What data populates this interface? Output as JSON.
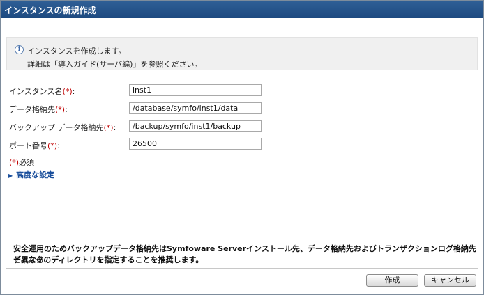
{
  "dialog": {
    "title": "インスタンスの新規作成"
  },
  "info": {
    "icon": "info-icon",
    "line1": "インスタンスを作成します。",
    "line2": "詳細は「導入ガイド(サーバ編)」を参照ください。"
  },
  "form": {
    "instance_name": {
      "label": "インスタンス名",
      "required_mark": "(*)",
      "colon": ":",
      "value": "inst1"
    },
    "data_dir": {
      "label": "データ格納先",
      "required_mark": "(*)",
      "colon": ":",
      "value": "/database/symfo/inst1/data"
    },
    "backup_dir": {
      "label": "バックアップ データ格納先",
      "required_mark": "(*)",
      "colon": ":",
      "value": "/backup/symfo/inst1/backup"
    },
    "port": {
      "label": "ポート番号",
      "required_mark": "(*)",
      "colon": ":",
      "value": "26500"
    }
  },
  "required_note": {
    "mark": "(*)",
    "text": "必須"
  },
  "advanced": {
    "icon": "triangle-right-icon",
    "label": "高度な設定"
  },
  "warning": {
    "line1": "安全運用のためバックアップデータ格納先はSymfoware Serverインストール先、データ格納先およびトランザクションログ格納先と異なる",
    "line2": "ディスクのディレクトリを指定することを推奨します。"
  },
  "buttons": {
    "create": "作成",
    "cancel": "キャンセル"
  }
}
